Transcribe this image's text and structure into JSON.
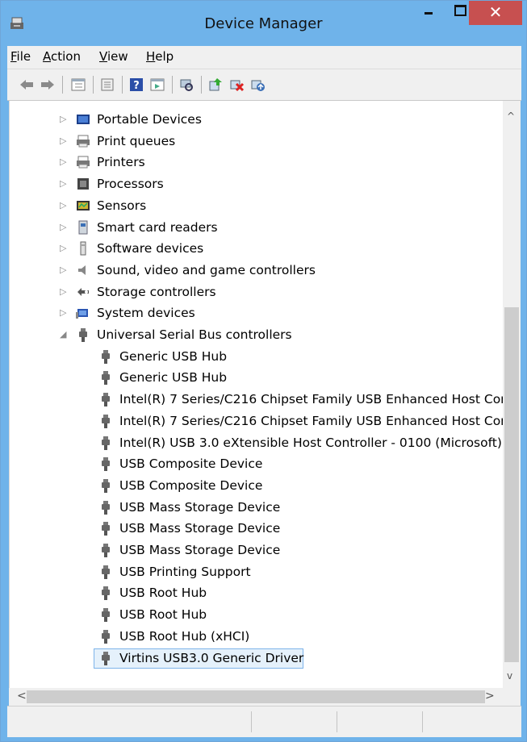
{
  "window": {
    "title": "Device Manager",
    "close_glyph": "✕"
  },
  "menu": [
    {
      "label": "File",
      "accel": "F",
      "rest": "ile"
    },
    {
      "label": "Action",
      "accel": "A",
      "rest": "ction"
    },
    {
      "label": "View",
      "accel": "V",
      "rest": "iew"
    },
    {
      "label": "Help",
      "accel": "H",
      "rest": "elp"
    }
  ],
  "toolbar_icons": [
    "back-icon",
    "forward-icon",
    "properties-grid-icon",
    "update-view-icon",
    "help-icon",
    "show-hidden-icon",
    "scan-hardware-icon",
    "update-driver-icon",
    "uninstall-icon",
    "enable-device-icon"
  ],
  "tree": {
    "categories": [
      {
        "label": "Portable Devices",
        "expanded": false,
        "icon": "portable-devices-icon"
      },
      {
        "label": "Print queues",
        "expanded": false,
        "icon": "printer-icon"
      },
      {
        "label": "Printers",
        "expanded": false,
        "icon": "printer-icon"
      },
      {
        "label": "Processors",
        "expanded": false,
        "icon": "processor-icon"
      },
      {
        "label": "Sensors",
        "expanded": false,
        "icon": "sensor-icon"
      },
      {
        "label": "Smart card readers",
        "expanded": false,
        "icon": "smart-card-icon"
      },
      {
        "label": "Software devices",
        "expanded": false,
        "icon": "software-device-icon"
      },
      {
        "label": "Sound, video and game controllers",
        "expanded": false,
        "icon": "speaker-icon"
      },
      {
        "label": "Storage controllers",
        "expanded": false,
        "icon": "storage-controller-icon"
      },
      {
        "label": "System devices",
        "expanded": false,
        "icon": "system-device-icon"
      },
      {
        "label": "Universal Serial Bus controllers",
        "expanded": true,
        "icon": "usb-icon"
      }
    ],
    "usb_children": [
      "Generic USB Hub",
      "Generic USB Hub",
      "Intel(R) 7 Series/C216 Chipset Family USB Enhanced Host Con",
      "Intel(R) 7 Series/C216 Chipset Family USB Enhanced Host Con",
      "Intel(R) USB 3.0 eXtensible Host Controller - 0100 (Microsoft)",
      "USB Composite Device",
      "USB Composite Device",
      "USB Mass Storage Device",
      "USB Mass Storage Device",
      "USB Mass Storage Device",
      "USB Printing Support",
      "USB Root Hub",
      "USB Root Hub",
      "USB Root Hub (xHCI)",
      "Virtins USB3.0 Generic Driver"
    ],
    "selected": "Virtins USB3.0 Generic Driver"
  },
  "glyphs": {
    "collapsed_arrow": "▷",
    "expanded_arrow": "◢",
    "scroll_up": "^",
    "scroll_down": "v",
    "scroll_left": "<",
    "scroll_right": ">"
  }
}
